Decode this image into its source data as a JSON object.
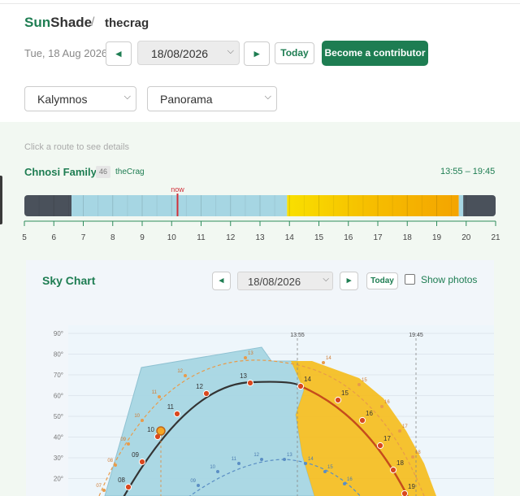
{
  "header": {
    "brand_sun": "Sun",
    "brand_shade": "Shade",
    "separator": "/",
    "crumb": "thecrag"
  },
  "controls": {
    "date_label": "Tue, 18 Aug 2026",
    "date_value": "18/08/2026",
    "prev": "◂",
    "next": "▸",
    "today": "Today",
    "contribute": "Become a contributor",
    "area": "Kalymnos",
    "sector": "Panorama"
  },
  "route_panel": {
    "hint": "Click a route to see details",
    "route_name": "Chnosi Family",
    "route_count": "46",
    "route_source": "theCrag",
    "sun_window": "13:55 – 19:45",
    "now_label": "now",
    "hours": [
      "5",
      "6",
      "7",
      "8",
      "9",
      "10",
      "11",
      "12",
      "13",
      "14",
      "15",
      "16",
      "17",
      "18",
      "19",
      "20",
      "21"
    ],
    "now_hour": 10.2,
    "night_end": 6.6,
    "shade_end": 13.92,
    "sun_end": 19.75,
    "dusk_end": 19.9
  },
  "sky_chart": {
    "title": "Sky Chart",
    "prev": "◂",
    "next": "▸",
    "date_value": "18/08/2026",
    "today": "Today",
    "show_photos": "Show photos",
    "alt_ticks": [
      "90°",
      "80°",
      "70°",
      "60°",
      "50°",
      "40°",
      "30°",
      "20°"
    ],
    "marker_labels": [
      "13:55",
      "19:45"
    ],
    "sun_path_hours": [
      "08",
      "09",
      "10",
      "11",
      "12",
      "13",
      "14",
      "15",
      "16",
      "17",
      "18",
      "19"
    ],
    "summer_path_hours": [
      "07",
      "08",
      "09",
      "10",
      "11",
      "12",
      "13",
      "14",
      "15",
      "16",
      "17",
      "18"
    ],
    "winter_path_hours": [
      "09",
      "10",
      "11",
      "12",
      "13",
      "14",
      "15",
      "16"
    ],
    "colors": {
      "accent": "#1e7d52",
      "sun_zone": "#f5bd1e",
      "shade_zone": "#a6d6e3",
      "path": "#333333",
      "sun_path": "#cc4a1a"
    }
  }
}
